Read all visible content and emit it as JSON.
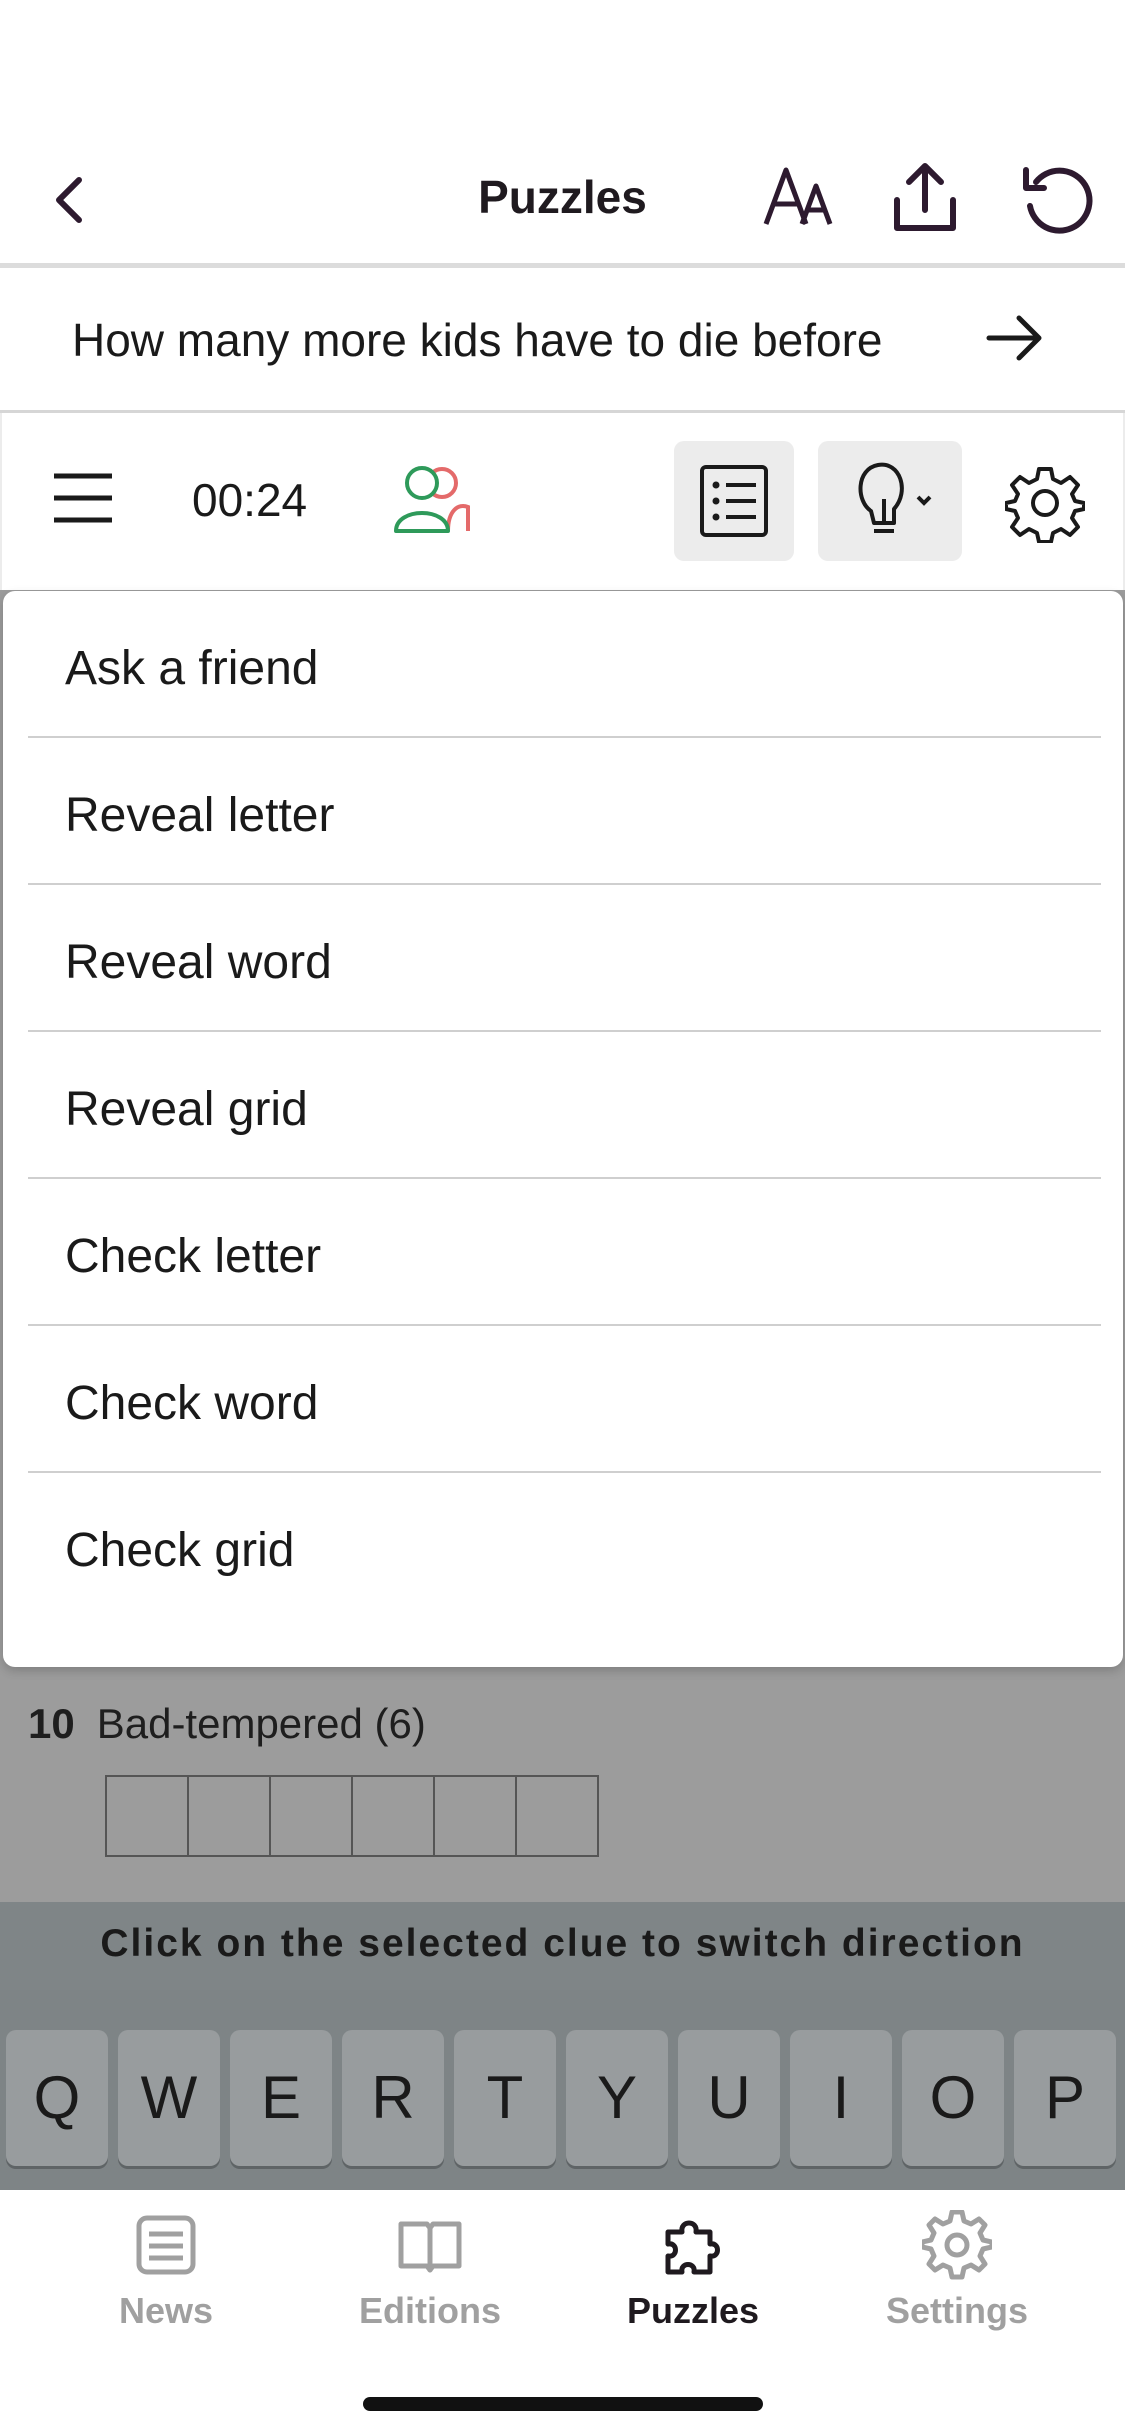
{
  "header": {
    "title": "Puzzles",
    "back_icon": "chevron-left-icon",
    "icons": [
      "text-size-icon",
      "share-icon",
      "reset-icon"
    ]
  },
  "banner": {
    "text": "How many more kids have to die before",
    "arrow_icon": "arrow-right-icon"
  },
  "toolbar": {
    "timer": "00:24",
    "icons": [
      "menu-icon",
      "friends-icon",
      "clue-list-icon",
      "hint-lightbulb-icon",
      "gear-icon"
    ]
  },
  "hint_menu": {
    "items": [
      "Ask a friend",
      "Reveal letter",
      "Reveal word",
      "Reveal grid",
      "Check letter",
      "Check word",
      "Check grid"
    ]
  },
  "clue": {
    "number": "10",
    "text": "Bad-tempered (6)",
    "length": 6
  },
  "switch_hint": "Click on the selected clue to switch direction",
  "keyboard": {
    "row1": [
      "Q",
      "W",
      "E",
      "R",
      "T",
      "Y",
      "U",
      "I",
      "O",
      "P"
    ]
  },
  "tabbar": {
    "tabs": [
      {
        "label": "News",
        "icon": "news-icon"
      },
      {
        "label": "Editions",
        "icon": "book-icon"
      },
      {
        "label": "Puzzles",
        "icon": "puzzle-icon",
        "active": true
      },
      {
        "label": "Settings",
        "icon": "settings-gear-icon"
      }
    ]
  },
  "colors": {
    "accent": "#2d1a2f",
    "friend_green": "#2e9a5a",
    "friend_red": "#e46a6a",
    "overlay": "#9c9c9c"
  }
}
